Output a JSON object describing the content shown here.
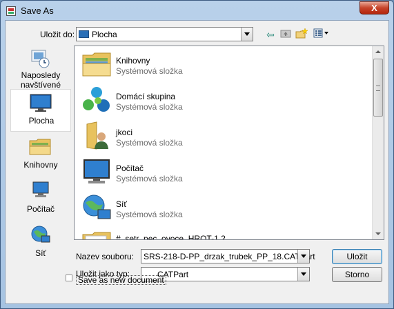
{
  "window": {
    "title": "Save As",
    "close_label": "X"
  },
  "toolbar": {
    "save_in_label": "Uložit do:",
    "location_value": "Plocha",
    "icons": [
      "back-arrow-icon",
      "up-folder-icon",
      "new-folder-icon",
      "views-menu-icon"
    ]
  },
  "places": [
    {
      "label": "Naposledy navštívené",
      "icon": "recent-places-icon"
    },
    {
      "label": "Plocha",
      "icon": "desktop-icon",
      "selected": true
    },
    {
      "label": "Knihovny",
      "icon": "libraries-icon"
    },
    {
      "label": "Počítač",
      "icon": "computer-icon"
    },
    {
      "label": "Síť",
      "icon": "network-icon"
    }
  ],
  "files": [
    {
      "name": "Knihovny",
      "type": "Systémová složka",
      "icon": "libraries-folder-icon"
    },
    {
      "name": "Domácí skupina",
      "type": "Systémová složka",
      "icon": "homegroup-icon"
    },
    {
      "name": "jkoci",
      "type": "Systémová složka",
      "icon": "user-folder-icon"
    },
    {
      "name": "Počítač",
      "type": "Systémová složka",
      "icon": "computer-icon"
    },
    {
      "name": "Síť",
      "type": "Systémová složka",
      "icon": "network-icon"
    },
    {
      "name": "#_setr_pec_ovoce_HROT-1.2",
      "type": "",
      "icon": "folder-icon"
    }
  ],
  "form": {
    "filename_label": "Nazev souboru:",
    "filename_value": "SRS-218-D-PP_drzak_trubek_PP_18.CATPart",
    "filetype_label": "Uložit jako typ:",
    "filetype_value": "CATPart",
    "save_as_new_label": "Save as new document",
    "save_button": "Uložit",
    "cancel_button": "Storno"
  }
}
